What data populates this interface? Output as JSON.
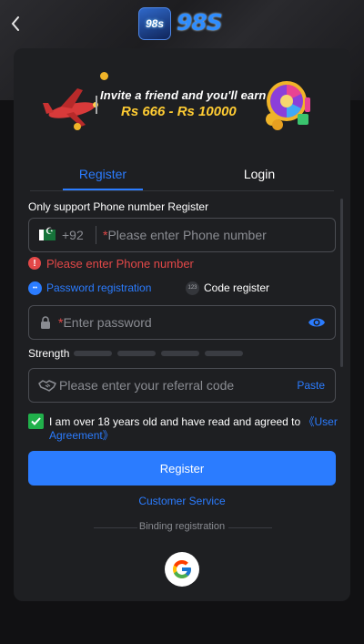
{
  "header": {
    "logo_badge": "98s",
    "logo_text": "98S"
  },
  "banner": {
    "line1": "Invite a friend and you'll earn",
    "line2": "Rs 666 - Rs 10000"
  },
  "tabs": [
    {
      "label": "Register",
      "active": true
    },
    {
      "label": "Login",
      "active": false
    }
  ],
  "form": {
    "support_label": "Only support Phone number Register",
    "phone": {
      "country_code": "+92",
      "required_mark": "*",
      "placeholder": "Please enter Phone number",
      "error": "Please enter Phone number"
    },
    "options": {
      "password_registration": "Password registration",
      "code_register": "Code register",
      "code_icon_text": "123"
    },
    "password": {
      "required_mark": "*",
      "placeholder": "Enter password"
    },
    "strength_label": "Strength",
    "strength_level": 0,
    "referral": {
      "placeholder": "Please enter your referral code",
      "paste": "Paste"
    },
    "agreement": {
      "checked": true,
      "text": "I am over 18 years old and have read and agreed to ",
      "link": "《User Agreement》"
    },
    "register_button": "Register",
    "customer_service": "Customer Service",
    "binding_label": "Binding registration"
  },
  "colors": {
    "accent": "#2b7cff",
    "error": "#e34848",
    "checkbox": "#21b04b",
    "card": "#1e1f22",
    "background": "#111113"
  }
}
